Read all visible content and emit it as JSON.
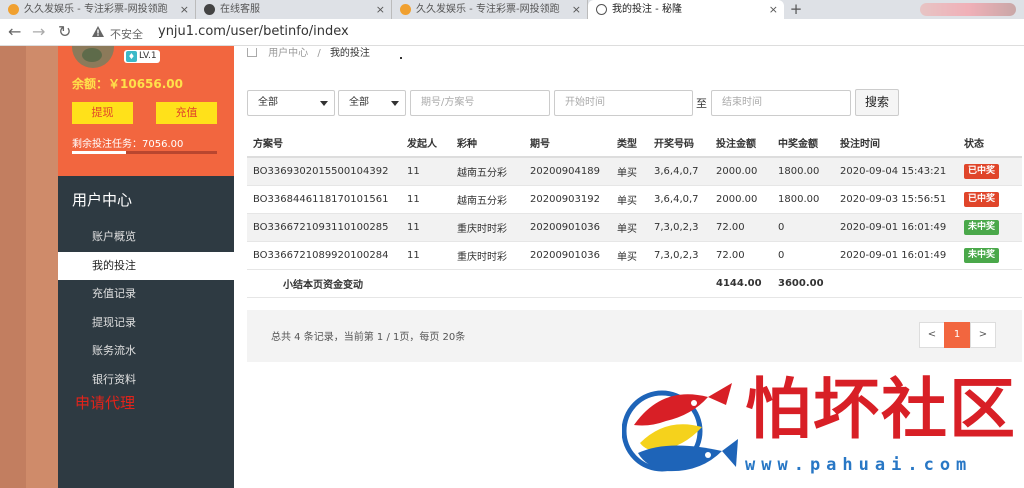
{
  "browser": {
    "tabs": [
      {
        "title": "久久发娱乐 - 专注彩票-网投领跑",
        "favicon": "orange"
      },
      {
        "title": "在线客服",
        "favicon": "dark"
      },
      {
        "title": "久久发娱乐 - 专注彩票-网投领跑",
        "favicon": "orange"
      },
      {
        "title": "我的投注 - 秘隆",
        "favicon": "globe",
        "active": true
      }
    ],
    "insecure_label": "不安全",
    "url": "ynju1.com/user/betinfo/index",
    "close_glyph": "×",
    "new_tab_glyph": "+"
  },
  "sidebar": {
    "level": "LV.1",
    "balance": "余额：￥10656.00",
    "withdraw_label": "提现",
    "deposit_label": "充值",
    "task": "剩余投注任务：7056.00",
    "task_progress": 0.37,
    "menu_title": "用户中心",
    "items": [
      {
        "label": "账户概览"
      },
      {
        "label": "我的投注",
        "active": true
      },
      {
        "label": "充值记录"
      },
      {
        "label": "提现记录"
      },
      {
        "label": "账务流水"
      },
      {
        "label": "银行资料"
      }
    ],
    "apply_agent": "申请代理",
    "accent": "#f2663f"
  },
  "breadcrumb": {
    "parent": "用户中心",
    "sep": "/",
    "current": "我的投注"
  },
  "filters": {
    "select1": "全部",
    "select2": "全部",
    "plan_placeholder": "期号/方案号",
    "start_placeholder": "开始时间",
    "to_label": "至",
    "end_placeholder": "结束时间",
    "search_label": "搜索"
  },
  "table": {
    "headers": [
      "方案号",
      "发起人",
      "彩种",
      "期号",
      "类型",
      "开奖号码",
      "投注金额",
      "中奖金额",
      "投注时间",
      "状态"
    ],
    "rows": [
      {
        "plan": "BO3369302015500104392",
        "initiator": "11",
        "lottery": "越南五分彩",
        "issue": "20200904189",
        "type": "单买",
        "draw": "3,6,4,0,7",
        "bet": "2000.00",
        "win": "1800.00",
        "time": "2020-09-04 15:43:21",
        "status": "已中奖",
        "status_color": "#e0452a",
        "win_red": true
      },
      {
        "plan": "BO3368446118170101561",
        "initiator": "11",
        "lottery": "越南五分彩",
        "issue": "20200903192",
        "type": "单买",
        "draw": "3,6,4,0,7",
        "bet": "2000.00",
        "win": "1800.00",
        "time": "2020-09-03 15:56:51",
        "status": "已中奖",
        "status_color": "#e0452a",
        "win_red": true
      },
      {
        "plan": "BO3366721093110100285",
        "initiator": "11",
        "lottery": "重庆时时彩",
        "issue": "20200901036",
        "type": "单买",
        "draw": "7,3,0,2,3",
        "bet": "72.00",
        "win": "0",
        "time": "2020-09-01 16:01:49",
        "status": "未中奖",
        "status_color": "#4aa84a",
        "win_red": false
      },
      {
        "plan": "BO3366721089920100284",
        "initiator": "11",
        "lottery": "重庆时时彩",
        "issue": "20200901036",
        "type": "单买",
        "draw": "7,3,0,2,3",
        "bet": "72.00",
        "win": "0",
        "time": "2020-09-01 16:01:49",
        "status": "未中奖",
        "status_color": "#4aa84a",
        "win_red": false
      }
    ],
    "summary": {
      "label": "小结本页资金变动",
      "bet_total": "4144.00",
      "win_total": "3600.00"
    }
  },
  "pager": {
    "info": "总共 4 条记录，当前第 1 / 1页，每页 20条",
    "prev": "<",
    "current": "1",
    "next": ">"
  },
  "watermark": {
    "text": "怕坏社区",
    "url": "www.pahuai.com"
  }
}
